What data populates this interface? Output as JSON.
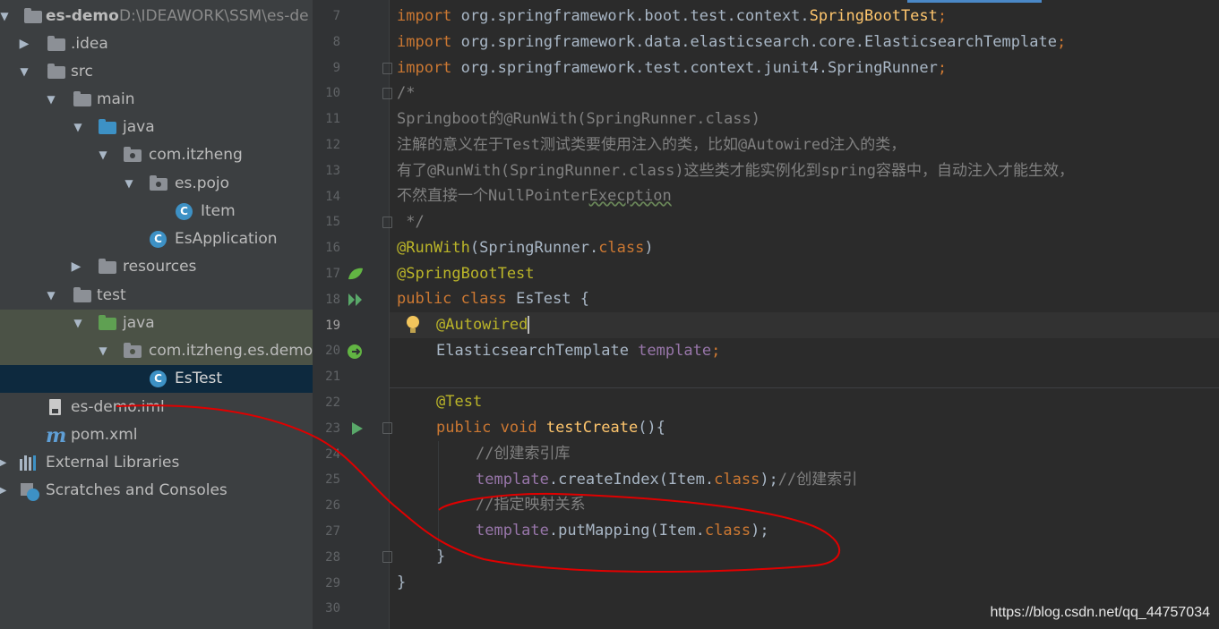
{
  "project_tree": {
    "root": {
      "name": "es-demo",
      "path": "D:\\IDEAWORK\\SSM\\es-de"
    },
    "items": [
      {
        "label": "es-demo",
        "path": "D:\\IDEAWORK\\SSM\\es-de"
      },
      {
        "label": ".idea"
      },
      {
        "label": "src"
      },
      {
        "label": "main"
      },
      {
        "label": "java"
      },
      {
        "label": "com.itzheng"
      },
      {
        "label": "es.pojo"
      },
      {
        "label": "Item"
      },
      {
        "label": "EsApplication"
      },
      {
        "label": "resources"
      },
      {
        "label": "test"
      },
      {
        "label": "java"
      },
      {
        "label": "com.itzheng.es.demo"
      },
      {
        "label": "EsTest"
      },
      {
        "label": "es-demo.iml"
      },
      {
        "label": "pom.xml"
      },
      {
        "label": "External Libraries"
      },
      {
        "label": "Scratches and Consoles"
      }
    ]
  },
  "editor": {
    "line_numbers": [
      "7",
      "8",
      "9",
      "10",
      "11",
      "12",
      "13",
      "14",
      "15",
      "16",
      "17",
      "18",
      "19",
      "20",
      "21",
      "22",
      "23",
      "24",
      "25",
      "26",
      "27",
      "28",
      "29",
      "30"
    ],
    "current_line": "19",
    "code": {
      "l7": {
        "kw": "import",
        "pkg": " org.springframework.boot.test.context.",
        "cls": "SpringBootTest",
        "end": ";"
      },
      "l8": {
        "kw": "import",
        "pkg": " org.springframework.data.elasticsearch.core.ElasticsearchTemplate",
        "end": ";"
      },
      "l9": {
        "kw": "import",
        "pkg": " org.springframework.test.context.junit4.SpringRunner",
        "end": ";"
      },
      "l10": "/*",
      "l11": "Springboot的@RunWith(SpringRunner.class)",
      "l12": "注解的意义在于Test测试类要使用注入的类，比如@Autowired注入的类，",
      "l13": "有了@RunWith(SpringRunner.class)这些类才能实例化到spring容器中，自动注入才能生效，",
      "l14a": "不然直接一个NullPointer",
      "l14b": "Execption",
      "l15": " */",
      "l16": {
        "ann": "@RunWith",
        "open": "(SpringRunner.",
        "kw": "class",
        "close": ")"
      },
      "l17": "@SpringBootTest",
      "l18": {
        "kw": "public class",
        "name": " EsTest {"
      },
      "l19": "@Autowired",
      "l20": {
        "type": "ElasticsearchTemplate ",
        "field": "template",
        "end": ";"
      },
      "l22": "@Test",
      "l23": {
        "kw": "public void",
        "method": " testCreate",
        "rest": "(){"
      },
      "l24": "//创建索引库",
      "l25": {
        "field": "template",
        "call": ".createIndex(Item.",
        "kw": "class",
        "rest": ");",
        "cmt": "//创建索引"
      },
      "l26": "//指定映射关系",
      "l27": {
        "field": "template",
        "call": ".putMapping(Item.",
        "kw": "class",
        "rest": ");"
      },
      "l28": "}",
      "l29": "}"
    }
  },
  "watermark": "https://blog.csdn.net/qq_44757034",
  "colors": {
    "keyword": "#cc7832",
    "annotation": "#bbb529",
    "field": "#9876aa",
    "comment": "#808080",
    "method": "#ffc66d",
    "scribble": "#e00000"
  },
  "icons": [
    "folder-icon",
    "package-icon",
    "class-icon",
    "spring-bean-icon",
    "run-icon",
    "lightbulb-icon",
    "maven-icon",
    "libraries-icon",
    "scratches-icon"
  ]
}
